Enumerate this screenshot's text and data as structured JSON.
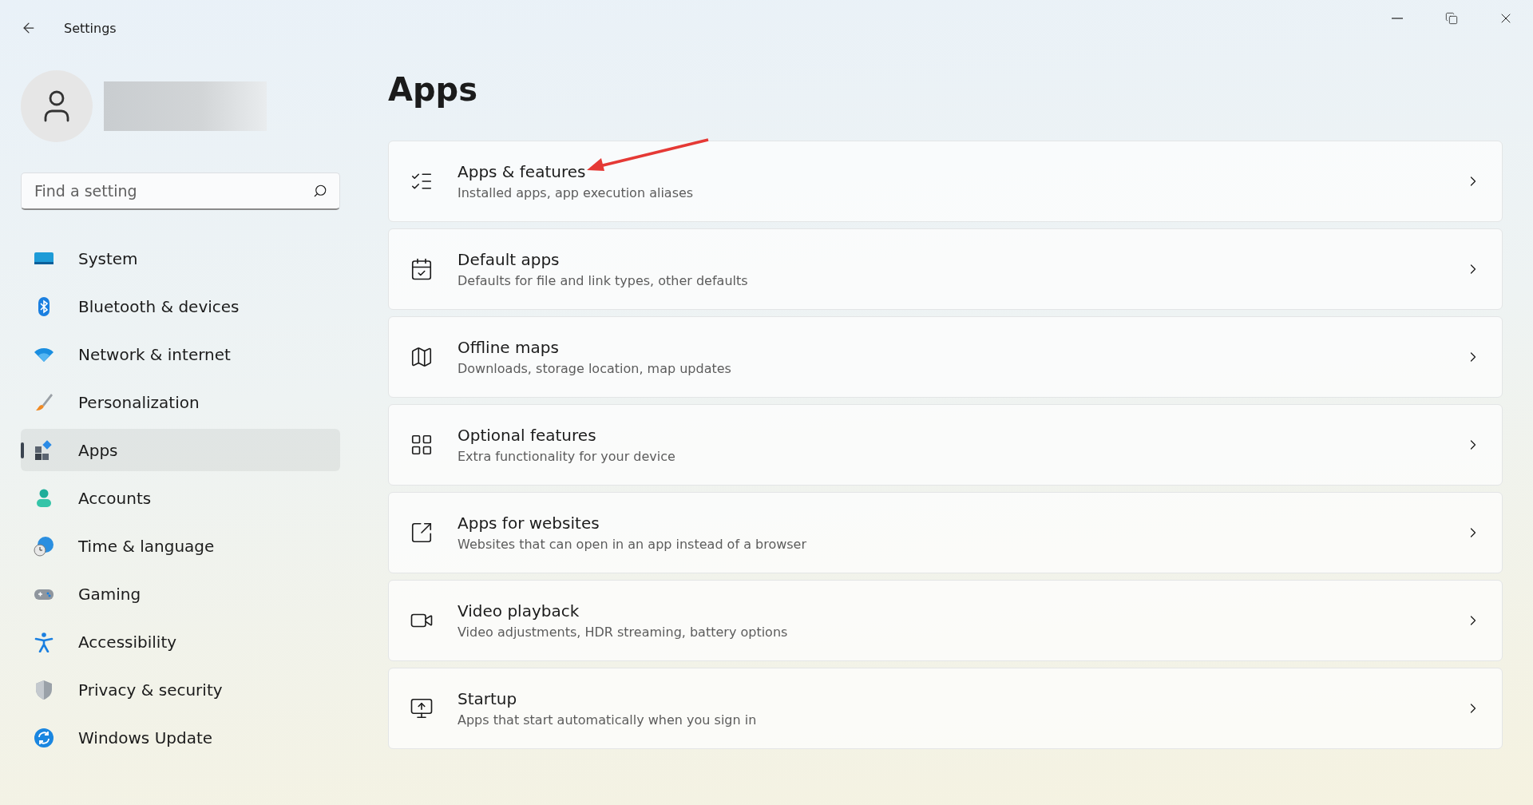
{
  "window": {
    "title": "Settings"
  },
  "search": {
    "placeholder": "Find a setting"
  },
  "nav": [
    {
      "label": "System",
      "selected": false
    },
    {
      "label": "Bluetooth & devices",
      "selected": false
    },
    {
      "label": "Network & internet",
      "selected": false
    },
    {
      "label": "Personalization",
      "selected": false
    },
    {
      "label": "Apps",
      "selected": true
    },
    {
      "label": "Accounts",
      "selected": false
    },
    {
      "label": "Time & language",
      "selected": false
    },
    {
      "label": "Gaming",
      "selected": false
    },
    {
      "label": "Accessibility",
      "selected": false
    },
    {
      "label": "Privacy & security",
      "selected": false
    },
    {
      "label": "Windows Update",
      "selected": false
    }
  ],
  "page_title": "Apps",
  "cards": [
    {
      "title": "Apps & features",
      "subtitle": "Installed apps, app execution aliases"
    },
    {
      "title": "Default apps",
      "subtitle": "Defaults for file and link types, other defaults"
    },
    {
      "title": "Offline maps",
      "subtitle": "Downloads, storage location, map updates"
    },
    {
      "title": "Optional features",
      "subtitle": "Extra functionality for your device"
    },
    {
      "title": "Apps for websites",
      "subtitle": "Websites that can open in an app instead of a browser"
    },
    {
      "title": "Video playback",
      "subtitle": "Video adjustments, HDR streaming, battery options"
    },
    {
      "title": "Startup",
      "subtitle": "Apps that start automatically when you sign in"
    }
  ]
}
